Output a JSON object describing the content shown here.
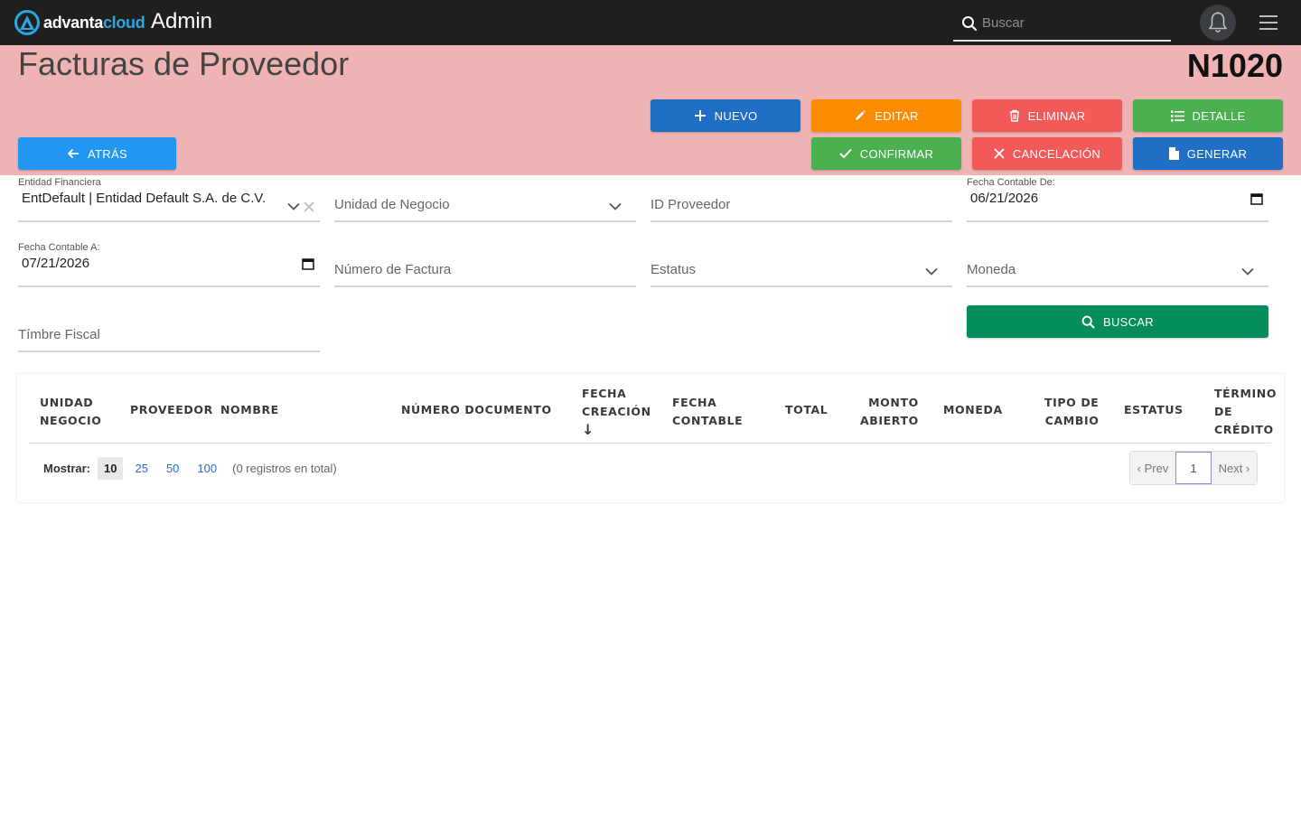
{
  "brand": {
    "name_part1": "advanta",
    "name_part2": "cloud",
    "accent": "#2aa6e0"
  },
  "topbar": {
    "app_title": "Admin",
    "search_placeholder": "Buscar",
    "icons": [
      "search-icon",
      "bell-icon",
      "hamburger-menu-icon"
    ]
  },
  "header": {
    "title": "Facturas de Proveedor",
    "code": "N1020",
    "background": "#efb3b3"
  },
  "actions": {
    "nuevo": "NUEVO",
    "editar": "EDITAR",
    "eliminar": "ELIMINAR",
    "detalle": "DETALLE",
    "atras": "ATRÁS",
    "confirmar": "CONFIRMAR",
    "cancelacion": "CANCELACIÓN",
    "generar": "GENERAR"
  },
  "filters": {
    "entidad": {
      "label": "Entidad Financiera",
      "value": "EntDefault | Entidad Default S.A. de C.V."
    },
    "unidad": {
      "placeholder": "Unidad de Negocio"
    },
    "proveedor": {
      "placeholder": "ID Proveedor"
    },
    "fecha_de": {
      "label": "Fecha Contable De:",
      "value": "06/21/2026"
    },
    "fecha_a": {
      "label": "Fecha Contable A:",
      "value": "07/21/2026"
    },
    "numero_factura": {
      "placeholder": "Número de Factura"
    },
    "estatus": {
      "placeholder": "Estatus"
    },
    "moneda": {
      "placeholder": "Moneda"
    },
    "timbre": {
      "placeholder": "Tímbre Fiscal"
    },
    "buscar_label": "BUSCAR"
  },
  "table": {
    "columns": [
      [
        "UNIDAD",
        "NEGOCIO"
      ],
      [
        "PROVEEDOR"
      ],
      [
        "NOMBRE"
      ],
      [
        "NÚMERO DOCUMENTO"
      ],
      [
        "FECHA",
        "CREACIÓN",
        "↓"
      ],
      [
        "FECHA",
        "CONTABLE"
      ],
      [
        "TOTAL"
      ],
      [
        "MONTO",
        "ABIERTO"
      ],
      [
        "MONEDA"
      ],
      [
        "TIPO DE",
        "CAMBIO"
      ],
      [
        "ESTATUS"
      ],
      [
        "TÉRMINO",
        "DE",
        "CRÉDITO"
      ]
    ],
    "show_label": "Mostrar:",
    "page_sizes": [
      "10",
      "25",
      "50",
      "100"
    ],
    "active_page_size": "10",
    "total_text": "(0 registros en total)",
    "pager": {
      "prev": "‹ Prev",
      "current": "1",
      "next": "Next ›"
    }
  }
}
